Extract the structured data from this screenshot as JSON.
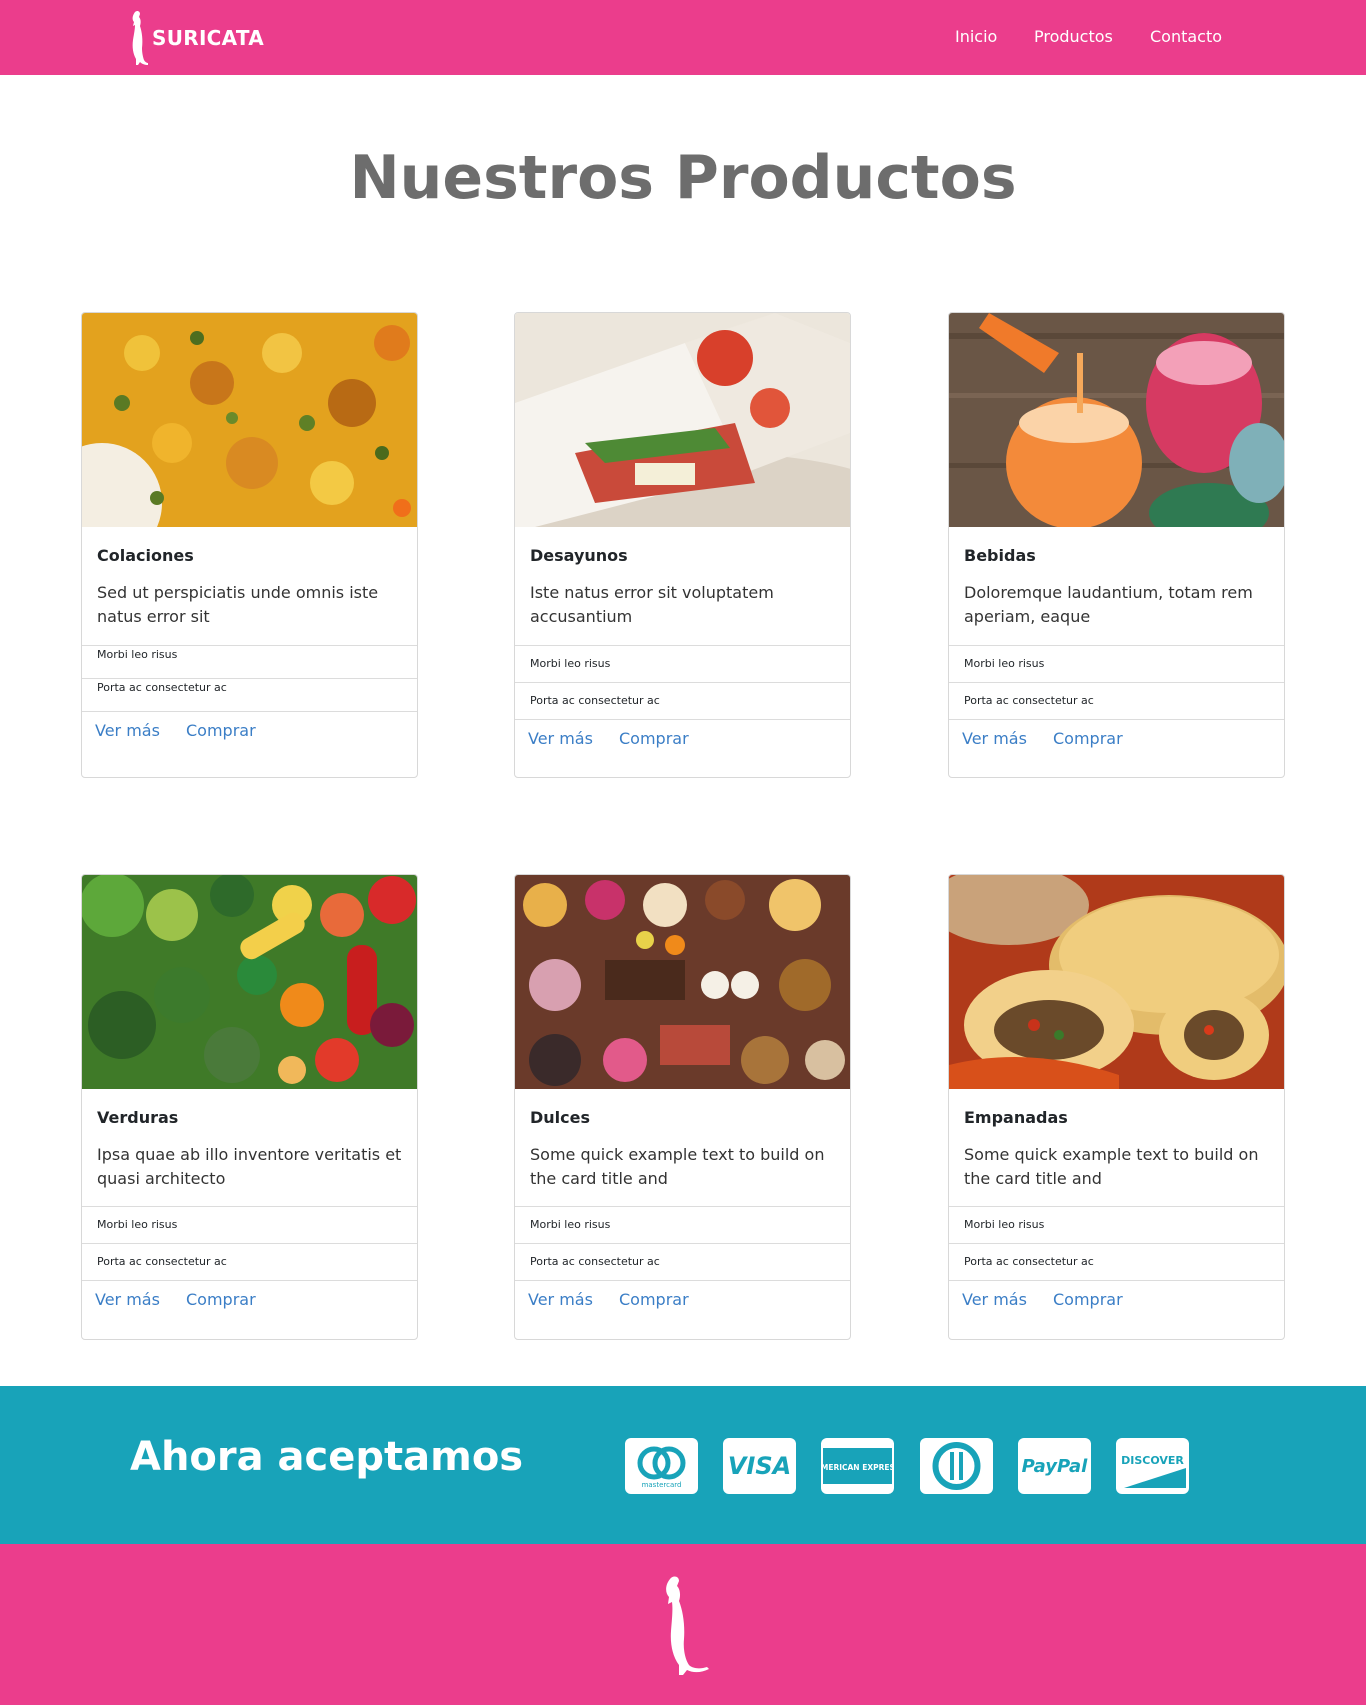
{
  "nav": {
    "brand": "SURICATA",
    "links": [
      "Inicio",
      "Productos",
      "Contacto"
    ]
  },
  "page_title": "Nuestros Productos",
  "cards": [
    {
      "title": "Colaciones",
      "text": "Sed ut perspiciatis unde omnis iste natus error sit",
      "items": [
        "Morbi leo risus",
        "Porta ac consectetur ac"
      ],
      "links": [
        "Ver más",
        "Comprar"
      ]
    },
    {
      "title": "Desayunos",
      "text": "Iste natus error sit voluptatem accusantium",
      "items": [
        "Morbi leo risus",
        "Porta ac consectetur ac"
      ],
      "links": [
        "Ver más",
        "Comprar"
      ]
    },
    {
      "title": "Bebidas",
      "text": "Doloremque laudantium, totam rem aperiam, eaque",
      "items": [
        "Morbi leo risus",
        "Porta ac consectetur ac"
      ],
      "links": [
        "Ver más",
        "Comprar"
      ]
    },
    {
      "title": "Verduras",
      "text": "Ipsa quae ab illo inventore veritatis et quasi architecto",
      "items": [
        "Morbi leo risus",
        "Porta ac consectetur ac"
      ],
      "links": [
        "Ver más",
        "Comprar"
      ]
    },
    {
      "title": "Dulces",
      "text": "Some quick example text to build on the card title and",
      "items": [
        "Morbi leo risus",
        "Porta ac consectetur ac"
      ],
      "links": [
        "Ver más",
        "Comprar"
      ]
    },
    {
      "title": "Empanadas",
      "text": "Some quick example text to build on the card title and",
      "items": [
        "Morbi leo risus",
        "Porta ac consectetur ac"
      ],
      "links": [
        "Ver más",
        "Comprar"
      ]
    }
  ],
  "payments": {
    "title": "Ahora aceptamos",
    "methods": [
      {
        "name": "mastercard-icon",
        "label": "mastercard"
      },
      {
        "name": "visa-icon",
        "label": "VISA"
      },
      {
        "name": "american-express-icon",
        "label": "AMERICAN EXPRESS"
      },
      {
        "name": "diners-club-icon",
        "label": ""
      },
      {
        "name": "paypal-icon",
        "label": "PayPal"
      },
      {
        "name": "discover-icon",
        "label": "DISCOVER"
      }
    ]
  },
  "colors": {
    "brand_pink": "#eb3d8c",
    "payments_teal": "#18a3b9",
    "link_blue": "#3b7ec6",
    "title_gray": "#6d6d6d"
  }
}
